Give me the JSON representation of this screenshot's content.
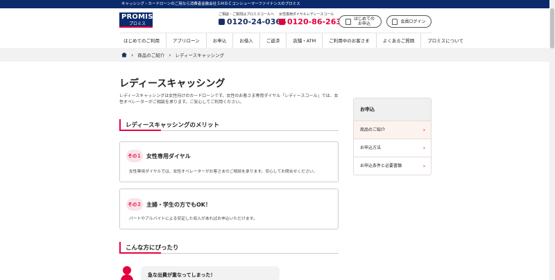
{
  "topbar": {
    "text": "キャッシング・カードローンのご用なら消費者金融会社ＳＭＢＣコンシューマーファイナンスのプロミス"
  },
  "logo": {
    "en": "PROMISE",
    "ja": "プロミス"
  },
  "tel1": {
    "caption": "ご相談・ご質問はプロミスコールへ",
    "number": "0120-24-0365"
  },
  "tel2": {
    "caption": "女性専用ダイヤルレディースコール",
    "number": "0120-86-2634"
  },
  "buttons": {
    "first_apply": "はじめての\nお申込",
    "login": "会員ログイン"
  },
  "nav": [
    "はじめてのご利用",
    "アプリローン",
    "お申込",
    "お借入",
    "ご返済",
    "店舗・ATM",
    "ご利用中のお客さま",
    "よくあるご質問",
    "プロミスについて"
  ],
  "breadcrumb": {
    "item1": "商品のご紹介",
    "item2": "レディースキャッシング"
  },
  "main": {
    "title": "レディースキャッシング",
    "intro": "レディースキャッシングは女性向けのカードローンです。女性のお客さま専用ダイヤル「レディースコール」では、女性オペレーターがご相談を承ります。ご安心してご利用ください。",
    "section1": "レディースキャッシングのメリット",
    "card1": {
      "badge": "その１",
      "title": "女性専用ダイヤル",
      "body": "女性専用ダイヤルでは、女性オペレーターがお客さまのご相談を承ります。安心してお問合せください。"
    },
    "card2": {
      "badge": "その２",
      "title": "主婦・学生の方でもOK！",
      "body": "パートやアルバイトによる安定した収入があればお申込いただけます。"
    },
    "section2": "こんな方にぴったり",
    "bubble1": "急な出費が重なってしまった！"
  },
  "sidebar": {
    "header": "お申込",
    "items": [
      {
        "label": "商品のご紹介"
      },
      {
        "label": "お申込方法"
      },
      {
        "label": "お申込条件と必要書類"
      }
    ]
  },
  "colors": {
    "brand_navy": "#0b2a6b",
    "accent_red": "#e5003f"
  }
}
